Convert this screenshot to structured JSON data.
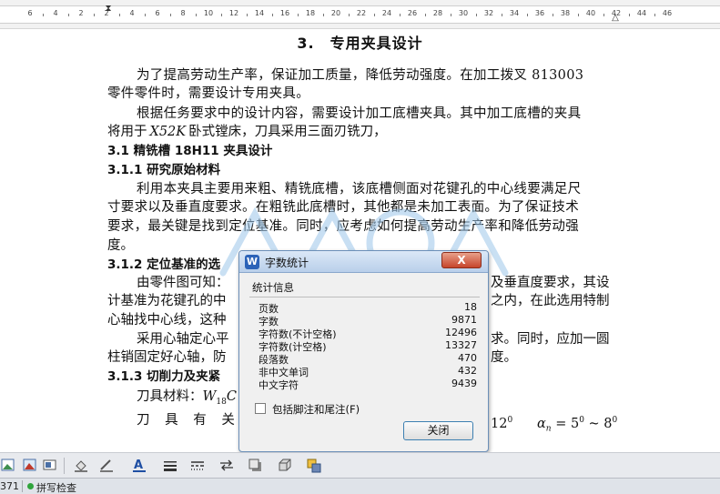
{
  "ruler": {
    "labels": [
      "6",
      "4",
      "2",
      "2",
      "4",
      "6",
      "8",
      "10",
      "12",
      "14",
      "16",
      "18",
      "20",
      "22",
      "24",
      "26",
      "28",
      "30",
      "32",
      "34",
      "36",
      "38",
      "40",
      "42",
      "44",
      "46"
    ]
  },
  "document": {
    "title": "3.　专用夹具设计",
    "p1_l1": "为了提高劳动生产率，保证加工质量，降低劳动强度。在加工拨叉 813003",
    "p1_l2": "零件零件时，需要设计专用夹具。",
    "p2_l1": "根据任务要求中的设计内容，需要设计加工底槽夹具。其中加工底槽的夹具",
    "p2_l2_pre": "将用于",
    "p2_l2_machine": "X52K",
    "p2_l2_post": "卧式镗床，刀具采用三面刃铣刀，",
    "h31": "3.1 精铣槽 18H11 夹具设计",
    "h311": "3.1.1 研究原始材料",
    "p3_l1": "利用本夹具主要用来粗、精铣底槽，该底槽侧面对花键孔的中心线要满足尺",
    "p3_l2": "寸要求以及垂直度要求。在粗铣此底槽时，其他都是未加工表面。为了保证技术",
    "p3_l3": "要求，最关键是找到定位基准。同时，应考虑如何提高劳动生产率和降低劳动强",
    "p3_l4": "度。",
    "h312_visible": "3.1.2 定位基准的选",
    "p4_l1_left": "由零件图可知：",
    "p4_l1_right": "及垂直度要求，其设",
    "p4_l2_left": "计基准为花键孔的中",
    "p4_l2_right": "之内，在此选用特制",
    "p4_l3_left": "心轴找中心线，这种",
    "p5_l1_left": "采用心轴定心平",
    "p5_l1_right": "求。同时，应加一圆",
    "p5_l2_left": "柱销固定好心轴，防",
    "p5_l2_right": "度。",
    "h313_visible": "3.1.3 切削力及夹紧",
    "p6_l1_pre": "刀具材料：",
    "p6_l1_symbol": "W",
    "p6_l1_sub": "18",
    "p6_l1_tail": "C",
    "p7_l1_left": "刀 具 有 关 几 何",
    "p7_deg": "12",
    "p7_sup": "0",
    "p7_alpha": "α",
    "p7_alpha_sub": "n",
    "p7_eq": " = 5",
    "p7_sup1": "0",
    "p7_tilde": " ~ 8",
    "p7_sup2": "0"
  },
  "dialog": {
    "icon_letter": "W",
    "title": "字数统计",
    "close_symbol": "X",
    "group_label": "统计信息",
    "rows": [
      {
        "label": "页数",
        "value": "18"
      },
      {
        "label": "字数",
        "value": "9871"
      },
      {
        "label": "字符数(不计空格)",
        "value": "12496"
      },
      {
        "label": "字符数(计空格)",
        "value": "13327"
      },
      {
        "label": "段落数",
        "value": "470"
      },
      {
        "label": "非中文单词",
        "value": "432"
      },
      {
        "label": "中文字符",
        "value": "9439"
      }
    ],
    "checkbox_label": "包括脚注和尾注(F)",
    "close_button": "关闭"
  },
  "statusbar": {
    "page_info": "371",
    "spell_check": "拼写检查"
  },
  "colors": {
    "accent_blue": "#2c63b8",
    "close_red": "#c6452b",
    "status_green": "#2fa43c",
    "watermark_blue": "#9cc6ea"
  }
}
